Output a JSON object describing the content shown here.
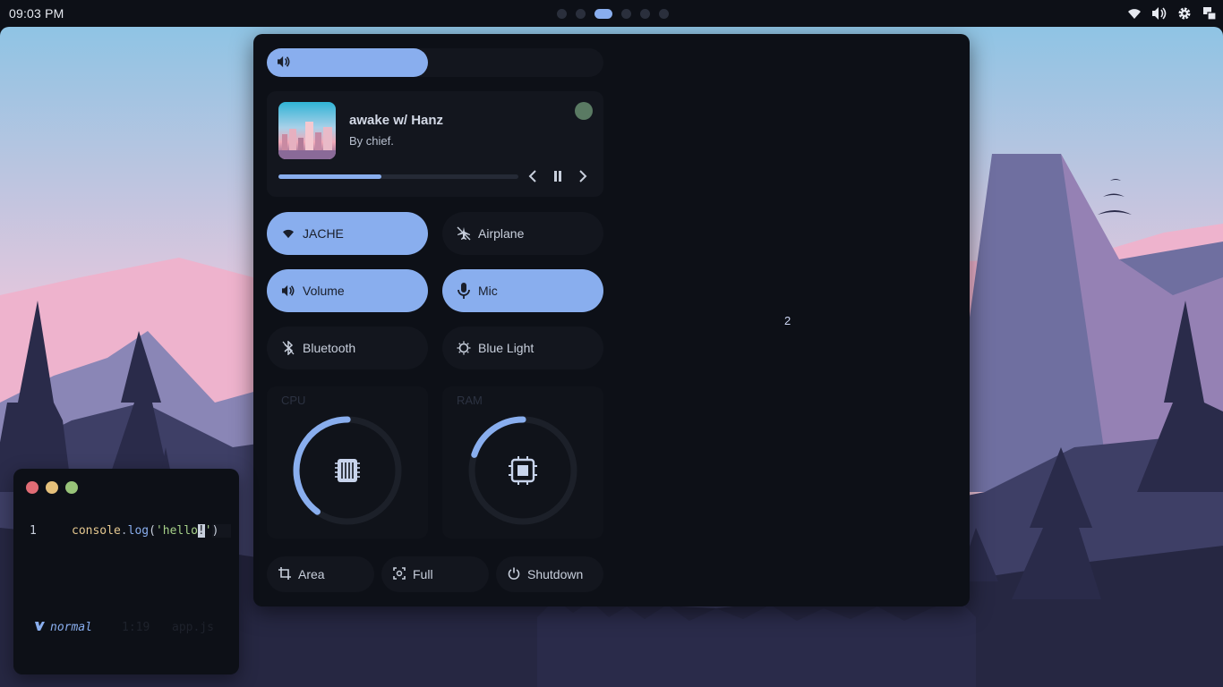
{
  "topbar": {
    "clock": "09:03 PM",
    "workspaces": [
      {
        "active": false
      },
      {
        "active": false
      },
      {
        "active": true
      },
      {
        "active": false
      },
      {
        "active": false
      },
      {
        "active": false
      }
    ],
    "tray_icons": [
      "wifi-icon",
      "volume-icon",
      "settings-icon",
      "layout-icon"
    ]
  },
  "panel": {
    "volume": {
      "icon": "volume-icon",
      "level_percent": 48
    },
    "media": {
      "title": "awake w/ Hanz",
      "artist": "By chief.",
      "progress_percent": 43,
      "controls": [
        "previous-icon",
        "pause-icon",
        "next-icon"
      ]
    },
    "toggles": [
      {
        "label": "JACHE",
        "icon": "wifi-icon",
        "on": true
      },
      {
        "label": "Airplane",
        "icon": "airplane-icon",
        "on": false
      },
      {
        "label": "Volume",
        "icon": "volume-icon",
        "on": true
      },
      {
        "label": "Mic",
        "icon": "microphone-icon",
        "on": true
      },
      {
        "label": "Bluetooth",
        "icon": "bluetooth-icon",
        "on": false
      },
      {
        "label": "Blue Light",
        "icon": "brightness-icon",
        "on": false
      }
    ],
    "gauges": [
      {
        "label": "CPU",
        "icon": "cpu-icon",
        "percent": 40
      },
      {
        "label": "RAM",
        "icon": "memory-icon",
        "percent": 20
      }
    ],
    "actions": [
      {
        "label": "Area",
        "icon": "crop-icon"
      },
      {
        "label": "Full",
        "icon": "screenshot-icon"
      },
      {
        "label": "Shutdown",
        "icon": "power-icon"
      }
    ],
    "notification_count": "2"
  },
  "terminal": {
    "line_number": "1",
    "code": {
      "obj": "console",
      "dot": ".",
      "method": "log",
      "open": "(",
      "str_before": "'hello",
      "cursor_char": "!",
      "str_after": "'",
      "close": ")"
    },
    "status": {
      "mode_icon": "vim-icon",
      "mode": "normal",
      "position": "1:19",
      "filename": "app.js"
    }
  },
  "colors": {
    "accent": "#89aeee",
    "bg": "#0d1017",
    "surface": "#13161e",
    "close": "#e06c75",
    "minimize": "#e5c07b",
    "maximize": "#98c379"
  }
}
